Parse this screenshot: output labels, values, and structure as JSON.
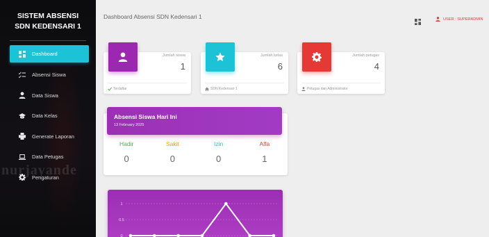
{
  "sidebar": {
    "brand_line1": "SISTEM ABSENSI",
    "brand_line2": "SDN KEDENSARI 1",
    "watermark": "nurjayande",
    "items": [
      {
        "label": "Dashboard",
        "icon": "dashboard-icon",
        "active": true
      },
      {
        "label": "Absensi Siswa",
        "icon": "checklist-icon",
        "active": false
      },
      {
        "label": "Data Siswa",
        "icon": "person-icon",
        "active": false
      },
      {
        "label": "Data Kelas",
        "icon": "graduation-cap-icon",
        "active": false
      },
      {
        "label": "Generate Laporan",
        "icon": "printer-icon",
        "active": false
      },
      {
        "label": "Data Petugas",
        "icon": "laptop-icon",
        "active": false
      },
      {
        "label": "Pengaturan",
        "icon": "gear-icon",
        "active": false
      }
    ]
  },
  "topbar": {
    "title": "Dashboard Absensi SDN Kedensari 1",
    "user_label": "USER : SUPERADMIN"
  },
  "stats": [
    {
      "label": "Jumlah siswa",
      "value": "1",
      "footer": "Terdaftar",
      "color": "#9c27b0",
      "icon": "person-icon"
    },
    {
      "label": "Jumlah kelas",
      "value": "6",
      "footer": "SDN Kedensari 1",
      "color": "#1cc2d6",
      "icon": "star-icon"
    },
    {
      "label": "Jumlah petugas",
      "value": "4",
      "footer": "Petugas dan Administrator",
      "color": "#e53935",
      "icon": "gear-icon"
    }
  ],
  "attendance": {
    "title": "Absensi Siswa Hari Ini",
    "date": "13 February 2025",
    "columns": [
      {
        "name": "Hadir",
        "value": "0",
        "color": "#4caf50"
      },
      {
        "name": "Sakit",
        "value": "0",
        "color": "#ff9800"
      },
      {
        "name": "Izin",
        "value": "0",
        "color": "#26c6da"
      },
      {
        "name": "Alfa",
        "value": "1",
        "color": "#e53935"
      }
    ]
  },
  "chart_data": {
    "type": "line",
    "y_ticks": [
      "1",
      "0.5",
      "0"
    ],
    "ylim": [
      0,
      1
    ],
    "series": [
      {
        "values": [
          0,
          0,
          0,
          0,
          1,
          0,
          0
        ]
      }
    ]
  }
}
